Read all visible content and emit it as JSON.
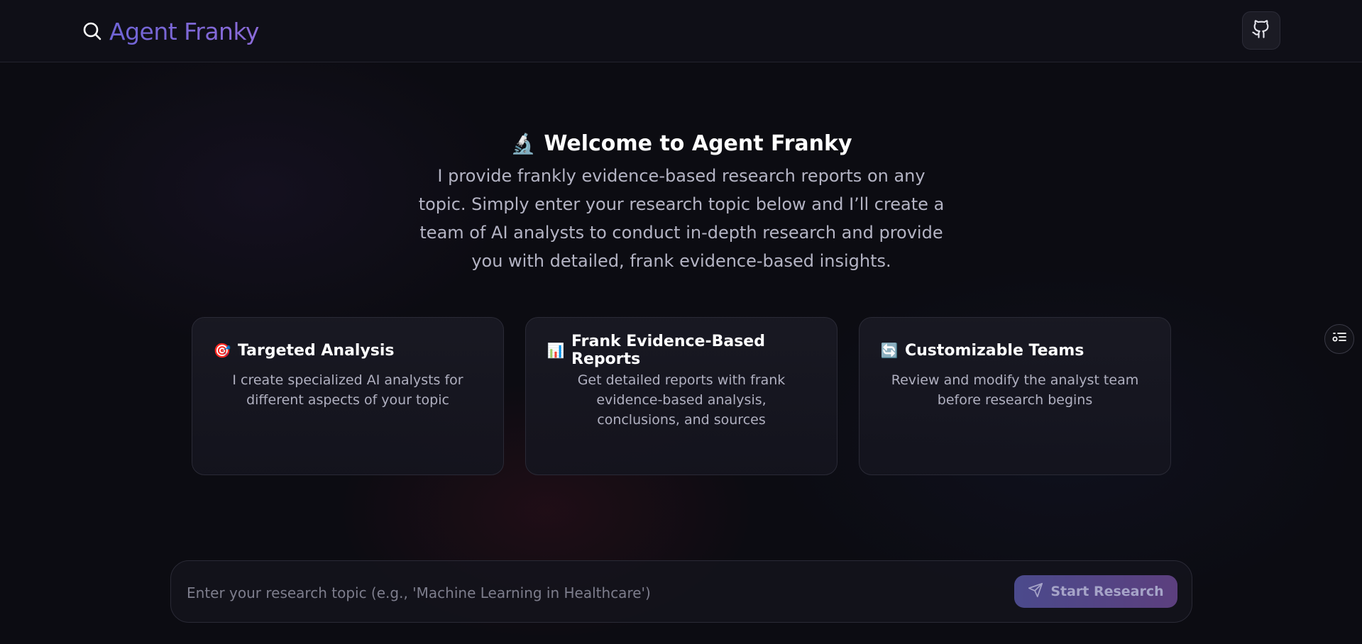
{
  "header": {
    "title": "Agent Franky",
    "search_icon": "search-icon",
    "github_icon": "github-icon"
  },
  "welcome": {
    "emoji": "🔬",
    "title": "Welcome to Agent Franky",
    "description": "I provide frankly evidence-based research reports on any topic. Simply enter your research topic below and I’ll create a team of AI analysts to conduct in-depth research and provide you with detailed, frank evidence-based insights."
  },
  "features": [
    {
      "emoji": "🎯",
      "title": "Targeted Analysis",
      "description": "I create specialized AI analysts for different aspects of your topic"
    },
    {
      "emoji": "📊",
      "title": "Frank Evidence-Based Reports",
      "description": "Get detailed reports with frank evidence-based analysis, conclusions, and sources"
    },
    {
      "emoji": "🔄",
      "title": "Customizable Teams",
      "description": "Review and modify the analyst team before research begins"
    }
  ],
  "side_panel_icon": "list-settings-icon",
  "search": {
    "placeholder": "Enter your research topic (e.g., 'Machine Learning in Healthcare')",
    "value": "",
    "button_label": "Start Research",
    "button_icon": "send-icon"
  },
  "colors": {
    "background": "#0c0c12",
    "header_bg": "#0f0f17",
    "brand_gradient_start": "#6f64d6",
    "brand_gradient_end": "#8b6bd8",
    "button_gradient_start": "#4b4a8c",
    "button_gradient_end": "#5c3f7e"
  }
}
